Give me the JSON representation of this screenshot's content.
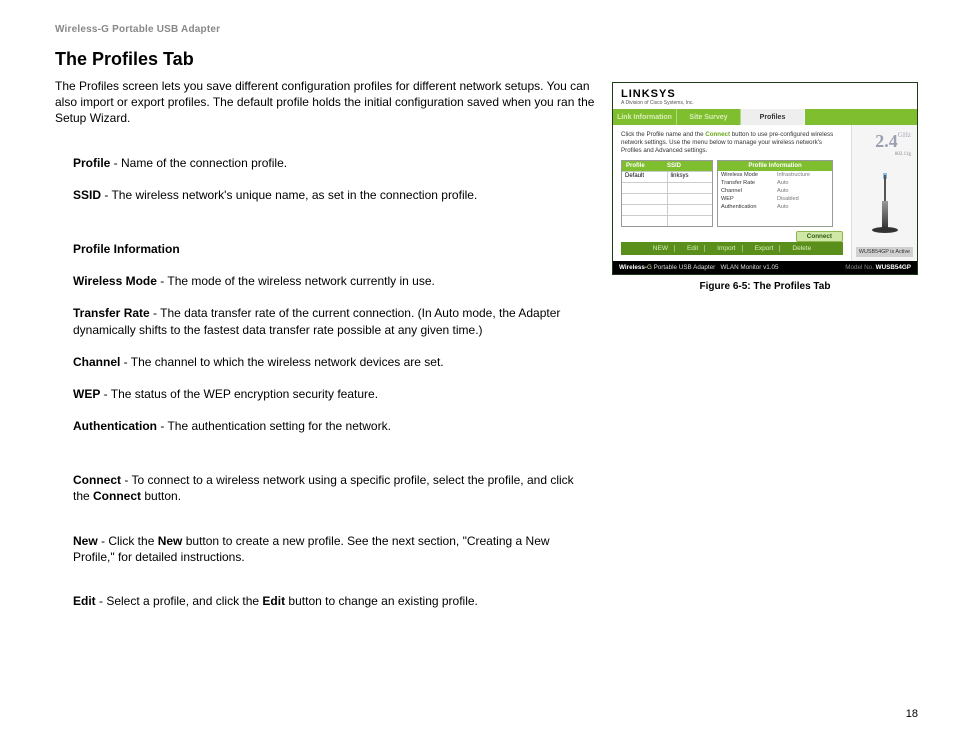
{
  "header": {
    "running": "Wireless-G Portable USB Adapter"
  },
  "title": "The Profiles Tab",
  "intro": "The Profiles screen lets you save different configuration profiles for different network setups. You can also import or export profiles. The default profile holds the initial configuration saved when you ran the Setup Wizard.",
  "defs": {
    "profile_term": "Profile",
    "profile_desc": " - Name of the connection profile.",
    "ssid_term": "SSID",
    "ssid_desc": " - The wireless network's unique name, as set in the connection profile.",
    "pi_heading": "Profile Information",
    "wm_term": "Wireless Mode",
    "wm_desc": " - The mode of the wireless network currently in use.",
    "tr_term": "Transfer Rate",
    "tr_desc": " - The data transfer rate of the current connection. (In Auto mode, the Adapter dynamically shifts to the fastest data transfer rate possible at any given time.)",
    "ch_term": "Channel",
    "ch_desc": " - The channel to which the wireless network devices are set.",
    "wep_term": "WEP",
    "wep_desc": " - The status of the WEP encryption security feature.",
    "auth_term": "Authentication",
    "auth_desc": " - The authentication setting for the network.",
    "connect_term": "Connect",
    "connect_mid": " - To connect to a wireless network using a specific profile, select the profile, and click the ",
    "connect_btn": "Connect",
    "connect_tail": " button.",
    "new_term": "New",
    "new_mid_a": " - Click the ",
    "new_bold": "New",
    "new_mid_b": " button to create a new profile. See the next section, \"Creating a New Profile,\" for detailed instructions.",
    "edit_term": "Edit",
    "edit_mid_a": " - Select a profile, and click the ",
    "edit_bold": "Edit",
    "edit_mid_b": " button to change an existing profile."
  },
  "figure": {
    "caption": "Figure 6-5: The Profiles Tab",
    "logo": "LINKSYS",
    "logo_sub": "A Division of Cisco Systems, Inc.",
    "tabs": {
      "link": "Link Information",
      "survey": "Site Survey",
      "profiles": "Profiles"
    },
    "instr_a": "Click the Profile name and the ",
    "instr_conn": "Connect",
    "instr_b": " button to use pre-configured wireless network settings. Use the menu below to manage your wireless network's Profiles and Advanced settings.",
    "col_profile": "Profile",
    "col_ssid": "SSID",
    "col_info": "Profile Information",
    "row_profile": "Default",
    "row_ssid": "linksys",
    "info": {
      "wm_k": "Wireless Mode",
      "wm_v": "Infrastructure",
      "tr_k": "Transfer Rate",
      "tr_v": "Auto",
      "ch_k": "Channel",
      "ch_v": "Auto",
      "wep_k": "WEP",
      "wep_v": "Disabled",
      "au_k": "Authentication",
      "au_v": "Auto"
    },
    "btn_connect": "Connect",
    "bar": {
      "new": "NEW",
      "edit": "Edit",
      "import": "Import",
      "export": "Export",
      "delete": "Delete"
    },
    "ghz_n": "2.4",
    "ghz_u": "GHz",
    "ghz_s": "802.11g",
    "status": "WUSB54GP is Active",
    "foot_brand_a": "Wireless-",
    "foot_brand_b": "G",
    "foot_prod": " Portable USB Adapter",
    "foot_mon": "WLAN Monitor  v1.05",
    "foot_model_lbl": "Model No.",
    "foot_model": "WUSB54GP"
  },
  "pagenum": "18"
}
